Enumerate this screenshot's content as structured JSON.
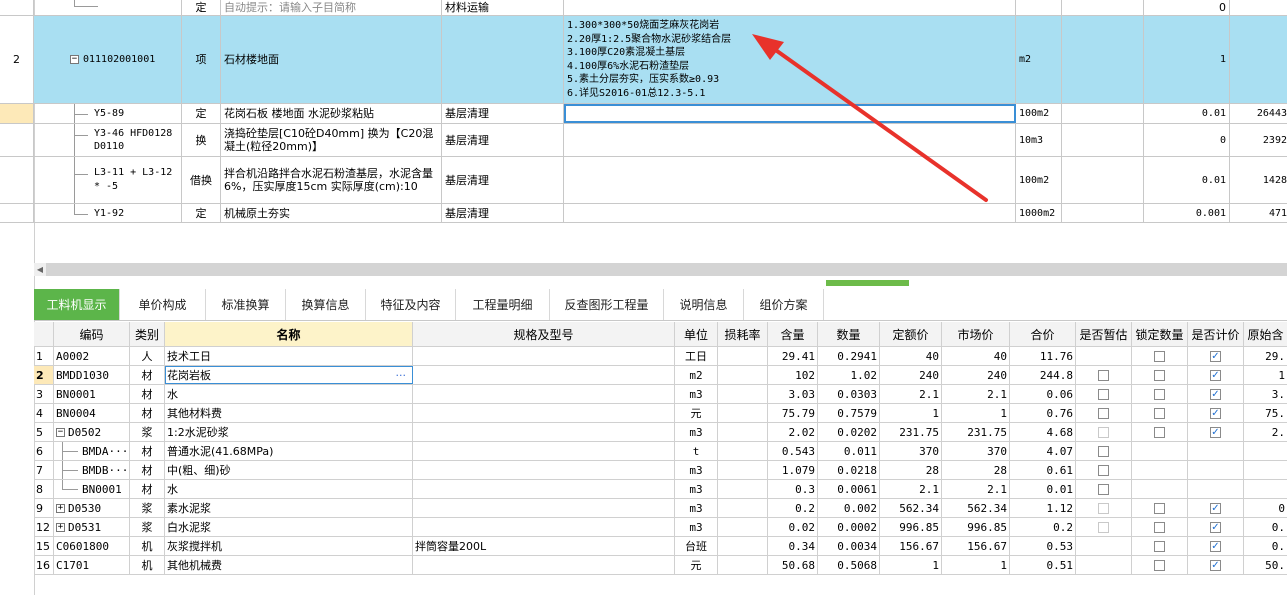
{
  "top_rows": [
    {
      "id": "r0",
      "num": "",
      "code": "",
      "type": "定",
      "name": "自动提示：请输入子目简称",
      "feature": "材料运输",
      "desc": [],
      "unit": "",
      "qty": "0",
      "price": ""
    },
    {
      "id": "r2",
      "num": "2",
      "code": "011102001001",
      "type": "项",
      "name": "石材楼地面",
      "feature": "",
      "desc": [
        "1.300*300*50烧面芝麻灰花岗岩",
        "2.20厚1:2.5聚合物水泥砂浆结合层",
        "3.100厚C20素混凝土基层",
        "4.100厚6%水泥石粉渣垫层",
        "5.素土分层夯实，压实系数≥0.93",
        "6.详见S2016-01总12.3-5.1"
      ],
      "unit": "m2",
      "qty": "1",
      "price": ""
    },
    {
      "id": "r3",
      "num": "",
      "code": "Y5-89",
      "type": "定",
      "name": "花岗石板 楼地面 水泥砂浆粘贴",
      "feature": "基层清理",
      "desc": [],
      "unit": "100m2",
      "qty": "0.01",
      "price": "26443"
    },
    {
      "id": "r4",
      "num": "",
      "code": "Y3-46 HFD0128 D0110",
      "type": "换",
      "name": "浇捣砼垫层[C10砼D40mm]  换为【C20混凝土(粒径20mm)】",
      "feature": "基层清理",
      "desc": [],
      "unit": "10m3",
      "qty": "0",
      "price": "2392"
    },
    {
      "id": "r5",
      "num": "",
      "code": "L3-11 + L3-12 * -5",
      "type": "借换",
      "name": "拌合机沿路拌合水泥石粉渣基层，水泥含量6%，压实厚度15cm  实际厚度(cm):10",
      "feature": "基层清理",
      "desc": [],
      "unit": "100m2",
      "qty": "0.01",
      "price": "1428"
    },
    {
      "id": "r6",
      "num": "",
      "code": "Y1-92",
      "type": "定",
      "name": "机械原土夯实",
      "feature": "基层清理",
      "desc": [],
      "unit": "1000m2",
      "qty": "0.001",
      "price": "471"
    }
  ],
  "tabs": [
    "工料机显示",
    "单价构成",
    "标准换算",
    "换算信息",
    "特征及内容",
    "工程量明细",
    "反查图形工程量",
    "说明信息",
    "组价方案"
  ],
  "columns": [
    "编码",
    "类别",
    "名称",
    "规格及型号",
    "单位",
    "损耗率",
    "含量",
    "数量",
    "定额价",
    "市场价",
    "合价",
    "是否暂估",
    "锁定数量",
    "是否计价",
    "原始含"
  ],
  "rows": [
    {
      "n": "1",
      "code": "A0002",
      "cat": "人",
      "name": "技术工日",
      "spec": "",
      "unit": "工日",
      "loss": "",
      "content": "29.41",
      "qty": "0.2941",
      "dprice": "40",
      "mprice": "40",
      "total": "11.76",
      "est": "none",
      "lock": "off",
      "priced": "on",
      "orig": "29."
    },
    {
      "n": "2",
      "code": "BMDD1030",
      "cat": "材",
      "name": "花岗岩板",
      "spec": "",
      "unit": "m2",
      "loss": "",
      "content": "102",
      "qty": "1.02",
      "dprice": "240",
      "mprice": "240",
      "total": "244.8",
      "est": "off",
      "lock": "off",
      "priced": "on",
      "orig": "1"
    },
    {
      "n": "3",
      "code": "BN0001",
      "cat": "材",
      "name": "水",
      "spec": "",
      "unit": "m3",
      "loss": "",
      "content": "3.03",
      "qty": "0.0303",
      "dprice": "2.1",
      "mprice": "2.1",
      "total": "0.06",
      "est": "off",
      "lock": "off",
      "priced": "on",
      "orig": "3."
    },
    {
      "n": "4",
      "code": "BN0004",
      "cat": "材",
      "name": "其他材料费",
      "spec": "",
      "unit": "元",
      "loss": "",
      "content": "75.79",
      "qty": "0.7579",
      "dprice": "1",
      "mprice": "1",
      "total": "0.76",
      "est": "off",
      "lock": "off",
      "priced": "on",
      "orig": "75."
    },
    {
      "n": "5",
      "code": "D0502",
      "cat": "浆",
      "name": "1:2水泥砂浆",
      "spec": "",
      "unit": "m3",
      "loss": "",
      "content": "2.02",
      "qty": "0.0202",
      "dprice": "231.75",
      "mprice": "231.75",
      "total": "4.68",
      "est": "dis",
      "lock": "off",
      "priced": "on",
      "orig": "2."
    },
    {
      "n": "6",
      "code": "BMDA···",
      "cat": "材",
      "name": "普通水泥(41.68MPa)",
      "spec": "",
      "unit": "t",
      "loss": "",
      "content": "0.543",
      "qty": "0.011",
      "dprice": "370",
      "mprice": "370",
      "total": "4.07",
      "est": "off",
      "lock": "none",
      "priced": "none",
      "orig": ""
    },
    {
      "n": "7",
      "code": "BMDB···",
      "cat": "材",
      "name": "中(粗、细)砂",
      "spec": "",
      "unit": "m3",
      "loss": "",
      "content": "1.079",
      "qty": "0.0218",
      "dprice": "28",
      "mprice": "28",
      "total": "0.61",
      "est": "off",
      "lock": "none",
      "priced": "none",
      "orig": ""
    },
    {
      "n": "8",
      "code": "BN0001",
      "cat": "材",
      "name": "水",
      "spec": "",
      "unit": "m3",
      "loss": "",
      "content": "0.3",
      "qty": "0.0061",
      "dprice": "2.1",
      "mprice": "2.1",
      "total": "0.01",
      "est": "off",
      "lock": "none",
      "priced": "none",
      "orig": ""
    },
    {
      "n": "9",
      "code": "D0530",
      "cat": "浆",
      "name": "素水泥浆",
      "spec": "",
      "unit": "m3",
      "loss": "",
      "content": "0.2",
      "qty": "0.002",
      "dprice": "562.34",
      "mprice": "562.34",
      "total": "1.12",
      "est": "dis",
      "lock": "off",
      "priced": "on",
      "orig": "0"
    },
    {
      "n": "12",
      "code": "D0531",
      "cat": "浆",
      "name": "白水泥浆",
      "spec": "",
      "unit": "m3",
      "loss": "",
      "content": "0.02",
      "qty": "0.0002",
      "dprice": "996.85",
      "mprice": "996.85",
      "total": "0.2",
      "est": "dis",
      "lock": "off",
      "priced": "on",
      "orig": "0."
    },
    {
      "n": "15",
      "code": "C0601800",
      "cat": "机",
      "name": "灰浆搅拌机",
      "spec": "拌筒容量200L",
      "unit": "台班",
      "loss": "",
      "content": "0.34",
      "qty": "0.0034",
      "dprice": "156.67",
      "mprice": "156.67",
      "total": "0.53",
      "est": "none",
      "lock": "off",
      "priced": "on",
      "orig": "0."
    },
    {
      "n": "16",
      "code": "C1701",
      "cat": "机",
      "name": "其他机械费",
      "spec": "",
      "unit": "元",
      "loss": "",
      "content": "50.68",
      "qty": "0.5068",
      "dprice": "1",
      "mprice": "1",
      "total": "0.51",
      "est": "none",
      "lock": "off",
      "priced": "on",
      "orig": "50."
    }
  ],
  "colors": {
    "selected_row": "#a9dff2",
    "active_tab": "#5cb54a",
    "arrow": "#e8322b",
    "header_highlight": "#fdf3c9"
  }
}
